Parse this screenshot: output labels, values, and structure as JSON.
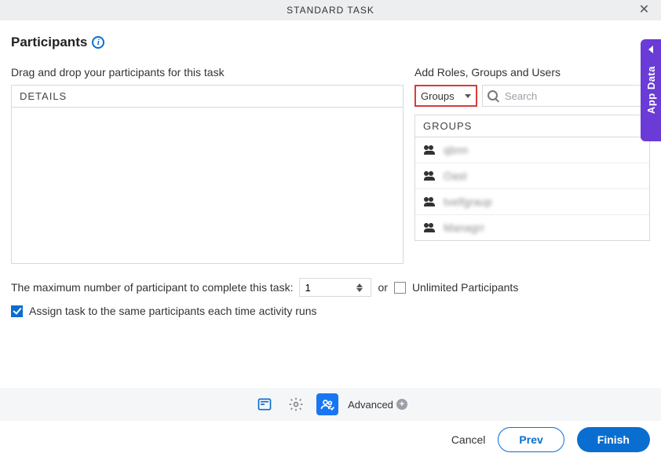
{
  "title": "STANDARD TASK",
  "app_data_label": "App Data",
  "heading": "Participants",
  "left_label": "Drag and drop your participants for this task",
  "drop_header": "DETAILS",
  "right_label": "Add Roles, Groups and Users",
  "type_select": {
    "value": "Groups"
  },
  "search": {
    "placeholder": "Search",
    "value": ""
  },
  "groups_header": "GROUPS",
  "groups": [
    {
      "name": "qbnn"
    },
    {
      "name": "Oast"
    },
    {
      "name": "tvelfgraup"
    },
    {
      "name": "Managrr"
    }
  ],
  "max_label": "The maximum number of participant to complete this task:",
  "max_value": "1",
  "or_label": "or",
  "unlimited_label": "Unlimited Participants",
  "unlimited_checked": false,
  "assign_label": "Assign task to the same participants each time activity runs",
  "assign_checked": true,
  "toolbar": {
    "advanced_label": "Advanced"
  },
  "footer": {
    "cancel": "Cancel",
    "prev": "Prev",
    "finish": "Finish"
  }
}
